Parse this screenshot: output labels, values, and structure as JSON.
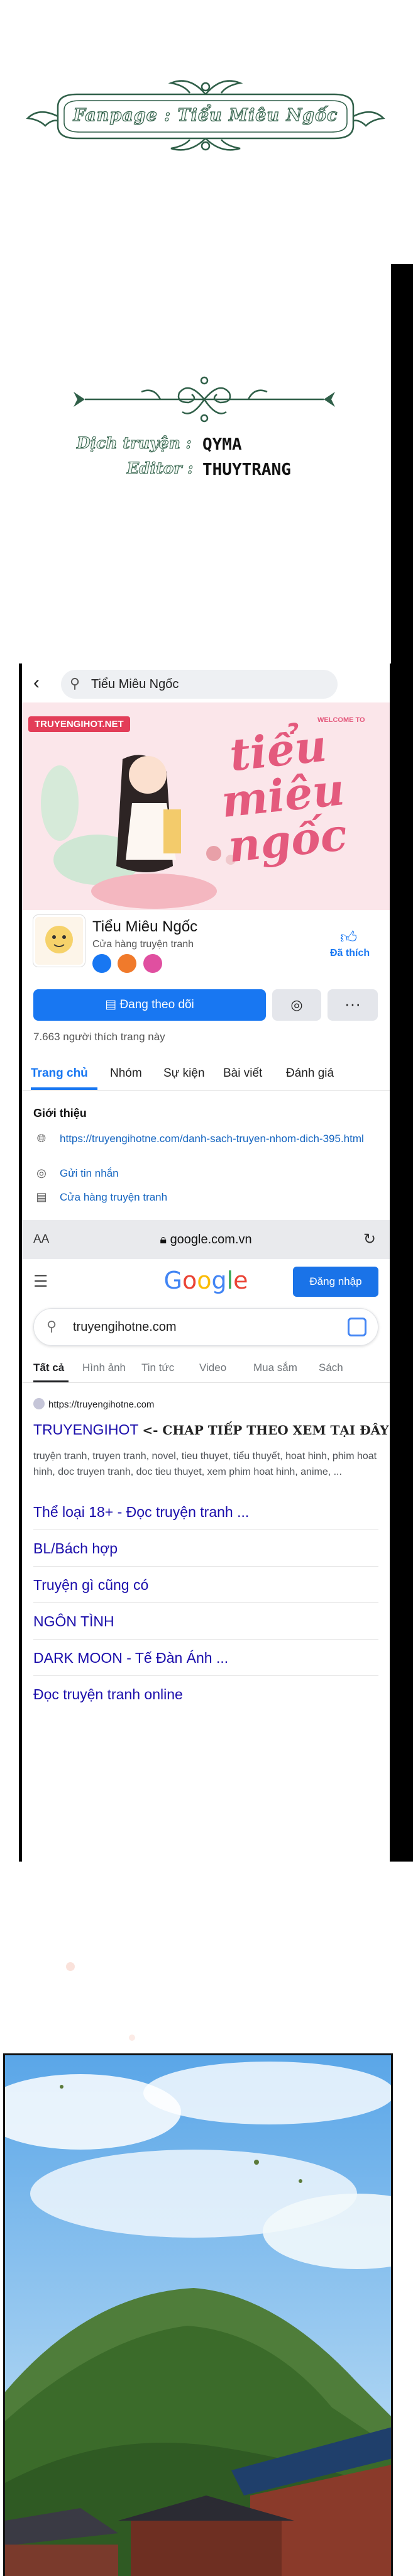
{
  "credits": {
    "fanpage": "Fanpage : Tiểu Miêu Ngốc",
    "translator_label": "Dịch truyện :",
    "translator_name": "QYMA",
    "editor_label": "Editor :",
    "editor_name": "THUYTRANG"
  },
  "facebook": {
    "search_query": "Tiểu Miêu Ngốc",
    "cover_logo": "TRUYENGIHOT.NET",
    "cover_welcome": "WELCOME TO",
    "cover_script": "tiểu miêu ngốc",
    "page_name": "Tiểu Miêu Ngốc",
    "page_type": "Cửa hàng truyện tranh",
    "like_label": "Đã thích",
    "follow_button": "Đang theo dõi",
    "followers_text": "7.663 người thích trang này",
    "tabs": [
      "Trang chủ",
      "Nhóm",
      "Sự kiện",
      "Bài viết",
      "Đánh giá"
    ],
    "intro_title": "Giới thiệu",
    "intro_link": "https://truyengihotne.com/danh-sach-truyen-nhom-dich-395.html",
    "intro_message": "Gửi tin nhắn",
    "intro_store": "Cửa hàng truyện tranh",
    "icons": [
      "back-arrow-icon",
      "search-icon",
      "thumbs-up-icon",
      "messenger-icon",
      "more-icon",
      "globe-icon",
      "shop-icon"
    ]
  },
  "browser": {
    "aa": "AA",
    "url": "google.com.vn"
  },
  "google": {
    "logo": "Google",
    "signin": "Đăng nhập",
    "search_query": "truyengihotne.com",
    "tabs": [
      "Tất cả",
      "Hình ảnh",
      "Tin tức",
      "Video",
      "Mua sắm",
      "Sách"
    ],
    "result_url": "https://truyengihotne.com",
    "result_title": "TRUYENGIHOT",
    "result_cta": "<- CHAP TIẾP THEO XEM TẠI ĐÂY NHA",
    "result_desc": "truyện tranh, truyen tranh, novel, tieu thuyet, tiểu thuyết, hoat hinh, phim hoat hinh, doc truyen tranh, doc tieu thuyet, xem phim hoat hinh, anime, ...",
    "sitelinks": [
      "Thể loại 18+ - Đọc truyện tranh ...",
      "BL/Bách hợp",
      "Truyện gì cũng có",
      "NGÔN TÌNH",
      "DARK MOON - Tế Đàn Ánh ...",
      "Đọc truyện tranh online"
    ],
    "colors": {
      "blue": "#4285f4",
      "red": "#ea4335",
      "yellow": "#fbbc05",
      "green": "#34a853",
      "link": "#1a0dab"
    }
  }
}
